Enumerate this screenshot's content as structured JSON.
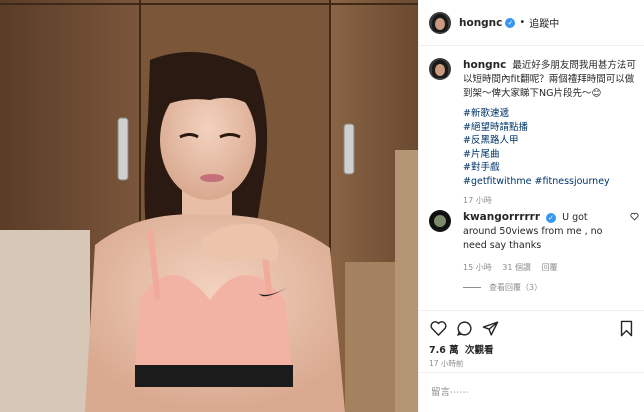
{
  "header": {
    "username": "hongnc",
    "verified_mark": "✓",
    "separator": "•",
    "follow_status": "追蹤中"
  },
  "caption": {
    "username": "hongnc",
    "text": "最近好多朋友問我用甚方法可以短時間內fit翻呢？兩個禮拜時間可以做到架～俾大家睇下NG片段先～😊",
    "hashtags": [
      "#新歌速遞",
      "#絕望時請點播",
      "#反黑路人甲",
      "#片尾曲",
      "#對手戲",
      "#getfitwithme #fitnessjourney"
    ],
    "time": "17 小時"
  },
  "comment": {
    "username": "kwangorrrrrr",
    "text": "U got around 50views from me , no need say thanks",
    "time": "15 小時",
    "likes": "31 個讚",
    "reply_label": "回覆",
    "view_replies": "查看回覆（3）"
  },
  "icons": {
    "heart": "heart-icon",
    "comment": "comment-icon",
    "share": "share-icon",
    "save": "bookmark-icon",
    "more": "more-icon"
  },
  "post": {
    "likes_count": "7.6 萬",
    "likes_label": "次觀看",
    "timestamp": "17 小時前"
  },
  "input": {
    "placeholder": "留言⋯⋯"
  },
  "colors": {
    "verified": "#3897f0",
    "text": "#262626",
    "muted": "#8e8e8e",
    "hashtag": "#003569"
  }
}
